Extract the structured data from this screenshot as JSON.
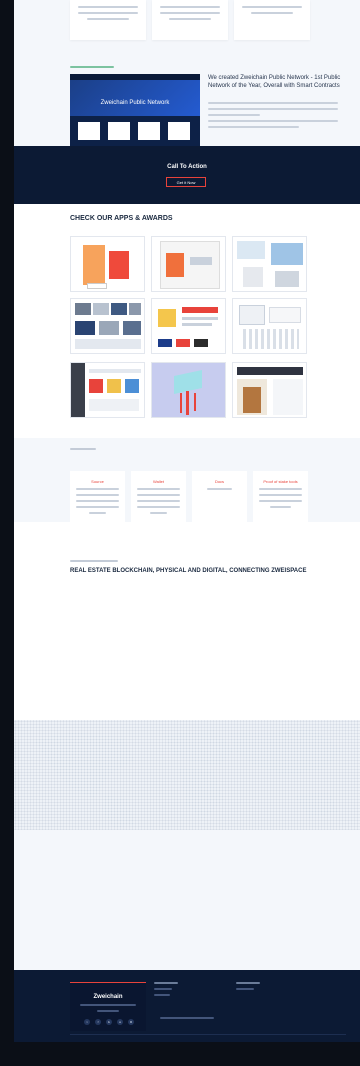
{
  "feature": {
    "shot_title": "Zweichain Public Network",
    "title": "We created Zweichain Public Network - 1st Public Network of the Year, Overall with Smart Contracts"
  },
  "cta": {
    "title": "Call To Action",
    "button": "Get it Now"
  },
  "apps": {
    "title": "CHECK OUR APPS & AWARDS"
  },
  "products": {
    "items": [
      {
        "title": "Source"
      },
      {
        "title": "Wallet"
      },
      {
        "title": "Docs"
      },
      {
        "title": "Proof of stake tools"
      }
    ]
  },
  "real_estate": {
    "title": "REAL ESTATE BLOCKCHAIN, PHYSICAL AND DIGITAL, CONNECTING ZWEISPACE"
  },
  "footer": {
    "brand": "Zweichain",
    "social_icons": [
      "twitter-icon",
      "facebook-icon",
      "telegram-icon",
      "github-icon",
      "medium-icon"
    ]
  },
  "colors": {
    "navy": "#0c1a34",
    "accent": "#e8433b",
    "light_bg": "#f4f7fb"
  }
}
